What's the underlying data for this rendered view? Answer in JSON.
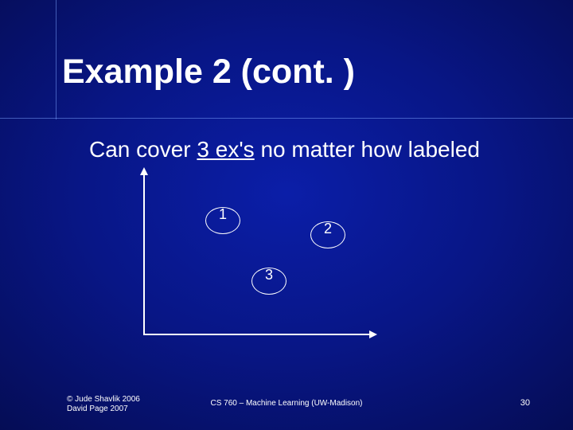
{
  "title": "Example 2 (cont. )",
  "body": {
    "pre": "Can cover ",
    "underlined": "3 ex's",
    "post": " no matter how labeled"
  },
  "points": {
    "p1": "1",
    "p2": "2",
    "p3": "3"
  },
  "footer": {
    "left_line1": "© Jude Shavlik 2006",
    "left_line2": "David Page 2007",
    "center": "CS 760 – Machine Learning (UW-Madison)",
    "right": "30"
  }
}
